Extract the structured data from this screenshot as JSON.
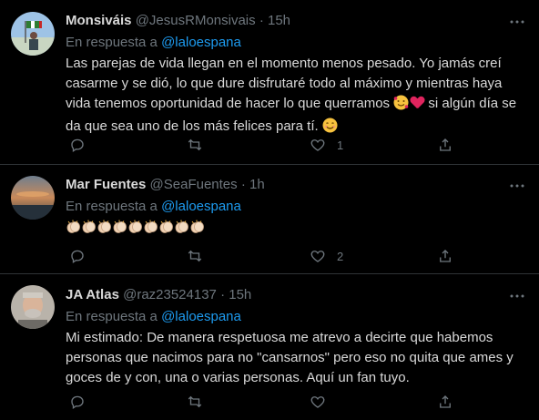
{
  "tweets": [
    {
      "name": "Monsiváis",
      "handle": "@JesusRMonsivais",
      "dot": "·",
      "time": "15h",
      "reply_prefix": "En respuesta a",
      "reply_to": "@laloespana",
      "text_part1": "Las parejas de vida llegan en el momento menos pesado. Yo jamás creí casarme y se dió, lo que dure disfrutaré todo al máximo y mientras haya vida tenemos oportunidad de hacer lo que querramos",
      "text_part2": " si algún día se da que sea uno de los más felices para tí.",
      "reply_count": "",
      "retweet_count": "",
      "like_count": "1"
    },
    {
      "name": "Mar Fuentes",
      "handle": "@SeaFuentes",
      "dot": "·",
      "time": "1h",
      "reply_prefix": "En respuesta a",
      "reply_to": "@laloespana",
      "clap_count": 9,
      "reply_count": "",
      "retweet_count": "",
      "like_count": "2"
    },
    {
      "name": "JA Atlas",
      "handle": "@raz23524137",
      "dot": "·",
      "time": "15h",
      "reply_prefix": "En respuesta a",
      "reply_to": "@laloespana",
      "text": "Mi estimado: De manera respetuosa me atrevo a decirte que habemos personas que nacimos para no \"cansarnos\" pero eso no quita que ames y goces de y con, una o varias personas. Aquí un fan tuyo.",
      "reply_count": "",
      "retweet_count": "",
      "like_count": ""
    }
  ],
  "icons": {
    "reply": "reply-icon",
    "retweet": "retweet-icon",
    "like": "heart-icon",
    "share": "share-icon",
    "more": "more-icon"
  },
  "colors": {
    "background": "#000000",
    "text": "#d9d9d9",
    "muted": "#6e767d",
    "link": "#1d9bf0",
    "divider": "#2f3336"
  }
}
